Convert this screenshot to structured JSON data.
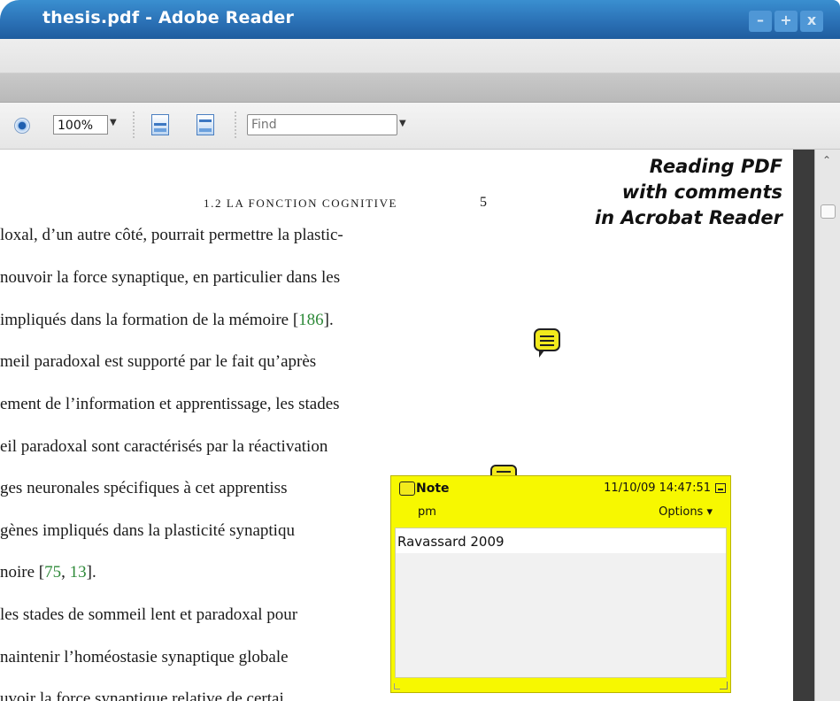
{
  "window": {
    "title": "thesis.pdf - Adobe Reader",
    "controls": {
      "minimize": "–",
      "maximize": "+",
      "close": "x"
    }
  },
  "toolbar": {
    "zoom": "100%",
    "find_placeholder": "Find"
  },
  "page": {
    "running_head": "1.2 LA FONCTION COGNITIVE",
    "page_number": "5",
    "lines": [
      {
        "text": "loxal, d’un autre côté, pourrait permettre la plastic-"
      },
      {
        "text": "nouvoir la force synaptique, en particulier dans les"
      },
      {
        "pre": "impliqués dans la formation de la mémoire [",
        "cite": "186",
        "post": "]."
      },
      {
        "text": "meil paradoxal est supporté par le fait qu’après"
      },
      {
        "text": "ement de l’information et apprentissage, les stades"
      },
      {
        "text": "eil paradoxal sont caractérisés par la réactivation"
      },
      {
        "text": "ges neuronales spécifiques à cet apprentiss"
      },
      {
        "text": "gènes impliqués dans la plasticité synaptiqu"
      },
      {
        "pre": "noire [",
        "cite": "75",
        "mid": ", ",
        "cite2": "13",
        "post": "]."
      },
      {
        "text": "les stades de sommeil lent et paradoxal pour"
      },
      {
        "text": "naintenir l’homéostasie synaptique globale"
      },
      {
        "text": "uvoir la force synaptique relative de certai"
      }
    ]
  },
  "caption": {
    "line1": "Reading PDF",
    "line2": "with comments",
    "line3": "in Acrobat Reader"
  },
  "note_popup": {
    "title": "Note",
    "date": "11/10/09 14:47:51",
    "author": "pm",
    "options_label": "Options ▾",
    "content": "Ravassard 2009"
  },
  "colors": {
    "titlebar": "#2a6fb4",
    "note_yellow": "#f7f800",
    "citation_green": "#2f8a3a"
  },
  "icons": [
    "radio-icon",
    "fit-width-icon",
    "fit-page-icon",
    "note-comment-icon",
    "mouse-cursor-icon",
    "minimize-note-icon"
  ]
}
